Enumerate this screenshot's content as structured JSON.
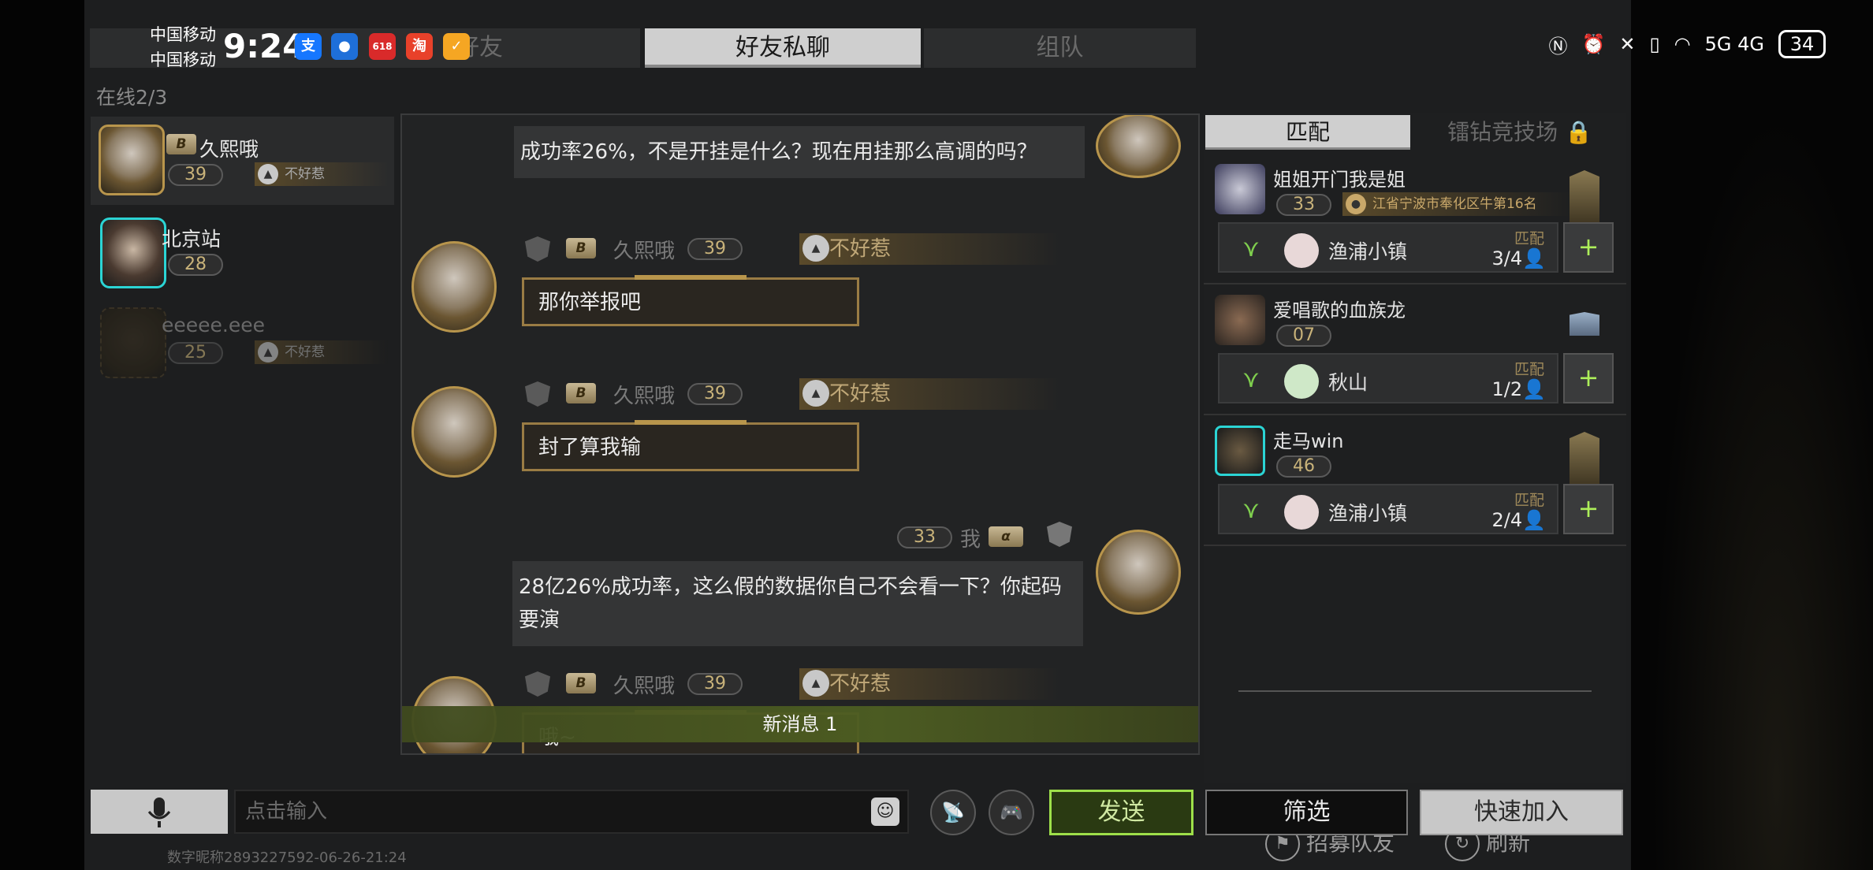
{
  "status_bar": {
    "carrier1": "中国移动",
    "carrier2": "中国移动",
    "time": "9:24",
    "apps": [
      "支",
      "●",
      "618",
      "淘",
      "✓"
    ],
    "signal": "5G 4G",
    "battery": "34"
  },
  "tabs": {
    "friends": "好友",
    "private_chat": "好友私聊",
    "team": "组队"
  },
  "online_count": "在线2/3",
  "friends": [
    {
      "name": "久熙哦",
      "level": "39",
      "tag": "不好惹"
    },
    {
      "name": "北京站",
      "level": "28"
    },
    {
      "name": "eeeee.eee",
      "level": "25",
      "tag": "不好惹"
    }
  ],
  "chat": {
    "messages": [
      {
        "text": "成功率26%，不是开挂是什么？现在用挂那么高调的吗？"
      },
      {
        "sender": "久熙哦",
        "level": "39",
        "tag": "不好惹",
        "text": "那你举报吧"
      },
      {
        "sender": "久熙哦",
        "level": "39",
        "tag": "不好惹",
        "text": "封了算我输"
      },
      {
        "sender": "我",
        "level": "33",
        "text": "28亿26%成功率，这么假的数据你自己不会看一下？你起码要演"
      },
      {
        "sender": "久熙哦",
        "level": "39",
        "tag": "不好惹",
        "text": "哦~"
      }
    ],
    "new_message": "新消息 1"
  },
  "match_panel": {
    "tab_match": "匹配",
    "tab_arena": "镭钻竞技场",
    "teams": [
      {
        "leader": "姐姐开门我是姐",
        "level": "33",
        "region": "江省宁波市奉化区牛第16名",
        "map": "渔浦小镇",
        "mode": "匹配",
        "count": "3/4"
      },
      {
        "leader": "爱唱歌的血族龙",
        "level": "07",
        "map": "秋山",
        "mode": "匹配",
        "count": "1/2"
      },
      {
        "leader": "走马win",
        "level": "46",
        "map": "渔浦小镇",
        "mode": "匹配",
        "count": "2/4"
      }
    ],
    "recruit": "招募队友",
    "refresh": "刷新"
  },
  "input": {
    "placeholder": "点击输入",
    "send": "发送",
    "filter": "筛选",
    "quick_join": "快速加入"
  },
  "watermark": "数字昵称2893227592-06-26-21:24"
}
